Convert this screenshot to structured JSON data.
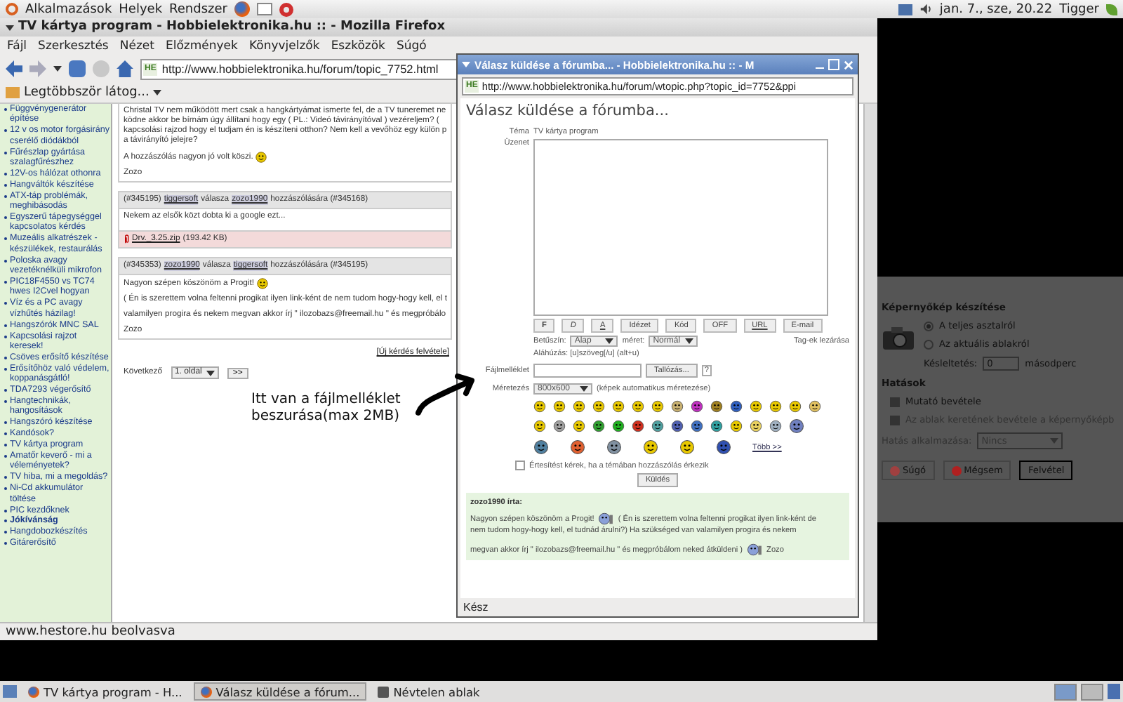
{
  "top_panel": {
    "menus": [
      "Alkalmazások",
      "Helyek",
      "Rendszer"
    ],
    "clock": "jan.  7., sze, 20.22",
    "user": "Tigger"
  },
  "browser": {
    "title": "TV kártya program - Hobbielektronika.hu :: - Mozilla Firefox",
    "menu": [
      "Fájl",
      "Szerkesztés",
      "Nézet",
      "Előzmények",
      "Könyvjelzők",
      "Eszközök",
      "Súgó"
    ],
    "site_icon": "HE",
    "url": "http://www.hobbielektronika.hu/forum/topic_7752.html",
    "bookmarks": "Legtöbbször látog...",
    "sidebar": [
      {
        "label": "Függvénygenerátor építése",
        "selected": false
      },
      {
        "label": "12 v os motor forgásirány cserélő diódákból",
        "selected": false
      },
      {
        "label": "Fűrészlap gyártása szalagfűrészhez",
        "selected": false
      },
      {
        "label": "12V-os hálózat othonra",
        "selected": false
      },
      {
        "label": "Hangváltók készítése",
        "selected": false
      },
      {
        "label": "ATX-táp problémák, meghibásodás",
        "selected": false
      },
      {
        "label": "Egyszerű tápegységgel kapcsolatos kérdés",
        "selected": false
      },
      {
        "label": "Muzeális alkatrészek - készülékek, restaurálás",
        "selected": false
      },
      {
        "label": "Poloska avagy vezetéknélküli mikrofon",
        "selected": false
      },
      {
        "label": "PIC18F4550 vs TC74 hwes I2Cvel hogyan",
        "selected": false
      },
      {
        "label": "Víz és a PC avagy vízhűtés házilag!",
        "selected": false
      },
      {
        "label": "Hangszórók MNC SAL",
        "selected": false
      },
      {
        "label": "Kapcsolási rajzot keresek!",
        "selected": false
      },
      {
        "label": "Csöves erősítő készítése",
        "selected": false
      },
      {
        "label": "Erősítőhöz való védelem, koppanásgátló!",
        "selected": false
      },
      {
        "label": "TDA7293 végerősítő",
        "selected": false
      },
      {
        "label": "Hangtechnikák, hangosítások",
        "selected": false
      },
      {
        "label": "Hangszóró készítése",
        "selected": false
      },
      {
        "label": "Kandósok?",
        "selected": false
      },
      {
        "label": "TV kártya program",
        "selected": false
      },
      {
        "label": "Amatőr keverő - mi a véleményetek?",
        "selected": false
      },
      {
        "label": "TV hiba, mi a megoldás?",
        "selected": false
      },
      {
        "label": "Ni-Cd akkumulátor töltése",
        "selected": false
      },
      {
        "label": "PIC kezdőknek",
        "selected": false
      },
      {
        "label": "Jókívánság",
        "selected": true
      },
      {
        "label": "Hangdobozkészítés",
        "selected": false
      },
      {
        "label": "Gitárerősítő",
        "selected": false
      }
    ],
    "posts": [
      {
        "paragraphs": [
          {
            "lines": [
              "Christal TV nem működött mert csak a hangkártyámat ismerte fel, de a TV tuneremet ne",
              "ködne akkor be bírnám úgy állítani hogy egy ( PL.: Videó távirányítóval ) vezéreljem? (",
              "kapcsolási rajzod hogy el tudjam én is készíteni otthon? Nem kell a vevőhöz egy külön p",
              "a távirányító jelejre?"
            ],
            "emoticon": false
          },
          {
            "lines": [
              "A hozzászólás nagyon jó volt köszi."
            ],
            "emoticon": true
          }
        ],
        "signature": "Zozo"
      },
      {
        "header": {
          "id": "(#345195)",
          "author": "tiggersoft",
          "verb": "válasza",
          "target": "zozo1990",
          "suffix": "hozzászólására (#345168)"
        },
        "paragraphs": [
          {
            "lines": [
              "Nekem az elsők közt dobta ki a google ezt..."
            ],
            "emoticon": false
          }
        ],
        "attachment": {
          "file": "Drv._3.25.zip",
          "size": "(193.42 KB)"
        }
      },
      {
        "header": {
          "id": "(#345353)",
          "author": "zozo1990",
          "verb": "válasza",
          "target": "tiggersoft",
          "suffix": "hozzászólására (#345195)"
        },
        "paragraphs": [
          {
            "lines": [
              "Nagyon szépen köszönöm a Progit!"
            ],
            "emoticon": true
          },
          {
            "lines": [
              "( Én is szerettem volna feltenni progikat ilyen link-ként de nem tudom hogy-hogy kell, el t"
            ],
            "emoticon": false
          },
          {
            "lines": [
              "valamilyen progira és nekem megvan akkor írj \" ilozobazs@freemail.hu \" és megpróbálo"
            ],
            "emoticon": false
          }
        ],
        "signature": "Zozo"
      }
    ],
    "new_topic_link": "[Új kérdés felvétele]",
    "pager": {
      "label": "Következő",
      "page": "1. oldal",
      "next": ">>"
    },
    "annotation": [
      "Itt van a fájlmelléklet",
      "beszurása(max 2MB)"
    ],
    "status": "www.hestore.hu beolvasva"
  },
  "popup": {
    "title": "Válasz küldése a fórumba... - Hobbielektronika.hu :: - M",
    "site_icon": "HE",
    "url": "http://www.hobbielektronika.hu/forum/wtopic.php?topic_id=7752&ppi",
    "heading": "Válasz küldése a fórumba...",
    "topic_label": "Téma",
    "topic": "TV kártya program",
    "message_label": "Üzenet",
    "format_buttons": [
      {
        "label": "F",
        "kind": "bold"
      },
      {
        "label": "D",
        "kind": "italic"
      },
      {
        "label": "A",
        "kind": "underline"
      },
      {
        "label": "Idézet",
        "kind": "plain"
      },
      {
        "label": "Kód",
        "kind": "plain"
      },
      {
        "label": "OFF",
        "kind": "plain"
      },
      {
        "label": "URL",
        "kind": "underline"
      },
      {
        "label": "E-mail",
        "kind": "plain"
      }
    ],
    "font_label": "Betűszín:",
    "font_value": "Alap",
    "size_label": "méret:",
    "size": "Normál",
    "close_tags": "Tag-ek lezárása",
    "hint": "Aláhúzás: [u]szöveg[/u]  (alt+u)",
    "attachment_label": "Fájlmelléklet",
    "browse": "Tallózás...",
    "help": "?",
    "resize_label": "Méretezés",
    "resize": "800x600",
    "resize_note": "(képek automatikus méretezése)",
    "more": "Több >>",
    "notify": {
      "label": "Értesítést kérek, ha a témában hozzászólás érkezik",
      "checked": false
    },
    "send": "Küldés",
    "quote": {
      "author": "zozo1990 írta:",
      "lines": [
        [
          {
            "text": "Nagyon szépen köszönöm a Progit!",
            "emoticon": true
          },
          {
            "text": "( Én is szerettem volna feltenni progikat ilyen link-ként de",
            "emoticon": false
          }
        ],
        [
          {
            "text": "nem tudom hogy-hogy kell, el tudnád árulni?) Ha szükséged van valamilyen progira és nekem",
            "emoticon": false
          }
        ],
        [
          {
            "text": "megvan akkor írj \" ilozobazs@freemail.hu \" és megpróbálom neked átküldeni )",
            "emoticon": true
          },
          {
            "text": "Zozo",
            "emoticon": false
          }
        ]
      ]
    },
    "status": "Kész"
  },
  "screenshot_dialog": {
    "title": "Képernyőkép készítése",
    "sources": [
      {
        "label": "A teljes asztalról",
        "selected": true
      },
      {
        "label": "Az aktuális ablakról",
        "selected": false
      }
    ],
    "delay_label": "Késleltetés:",
    "delay": "0",
    "delay_unit": "másodperc",
    "effects_title": "Hatások",
    "effects": [
      {
        "label": "Mutató bevétele",
        "checked": true,
        "disabled": false
      },
      {
        "label": "Az ablak keretének bevétele a képernyőképb",
        "checked": true,
        "disabled": true
      }
    ],
    "apply_label": "Hatás alkalmazása:",
    "apply": "Nincs",
    "apply_disabled": true,
    "buttons": [
      {
        "label": "Súgó",
        "kind": "help"
      },
      {
        "label": "Mégsem",
        "kind": "cancel"
      },
      {
        "label": "Felvétel",
        "kind": "ok"
      }
    ]
  },
  "taskbar": [
    {
      "label": "TV kártya program - H...",
      "selected": false,
      "kind": "browser"
    },
    {
      "label": "Válasz küldése a fórum...",
      "selected": true,
      "kind": "browser"
    },
    {
      "label": "Névtelen ablak",
      "selected": false,
      "kind": "camera"
    }
  ]
}
